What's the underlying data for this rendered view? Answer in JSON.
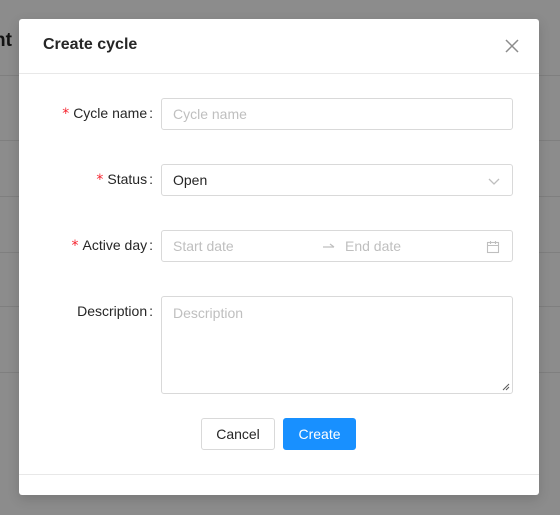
{
  "background": {
    "title_fragment": "nt"
  },
  "modal": {
    "title": "Create cycle",
    "fields": {
      "cycle_name": {
        "label": "Cycle name",
        "required": true,
        "placeholder": "Cycle name",
        "value": ""
      },
      "status": {
        "label": "Status",
        "required": true,
        "value": "Open"
      },
      "active_day": {
        "label": "Active day",
        "required": true,
        "start_placeholder": "Start date",
        "end_placeholder": "End date"
      },
      "description": {
        "label": "Description",
        "required": false,
        "placeholder": "Description"
      }
    },
    "buttons": {
      "cancel": "Cancel",
      "create": "Create"
    }
  },
  "colors": {
    "primary": "#1890ff",
    "required": "#f5222d",
    "border": "#d9d9d9",
    "placeholder": "#bfbfbf"
  }
}
